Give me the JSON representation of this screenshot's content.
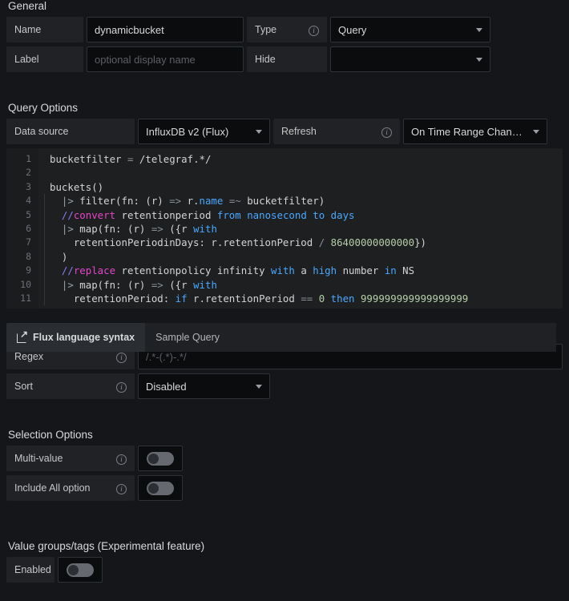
{
  "general": {
    "title": "General",
    "name_label": "Name",
    "name_value": "dynamicbucket",
    "label_label": "Label",
    "label_placeholder": "optional display name",
    "type_label": "Type",
    "type_value": "Query",
    "hide_label": "Hide",
    "hide_value": ""
  },
  "query_options": {
    "title": "Query Options",
    "datasource_label": "Data source",
    "datasource_value": "InfluxDB v2 (Flux)",
    "refresh_label": "Refresh",
    "refresh_value": "On Time Range Chan…"
  },
  "editor": {
    "line_numbers": [
      "1",
      "2",
      "3",
      "4",
      "5",
      "6",
      "7",
      "8",
      "9",
      "10",
      "11"
    ],
    "lines": [
      "bucketfilter = /telegraf.*/",
      "",
      "buckets()",
      "  |> filter(fn: (r) => r.name =~ bucketfilter)",
      "  //convert retentionperiod from nanosecond to days",
      "  |> map(fn: (r) => ({r with",
      "    retentionPeriodinDays: r.retentionPeriod / 86400000000000})",
      "  )",
      "  //replace retentionpolicy infinity with a high number in NS",
      "  |> map(fn: (r) => ({r with",
      "    retentionPeriod: if r.retentionPeriod == 0 then 999999999999999999"
    ]
  },
  "tabs": {
    "flux_syntax": "Flux language syntax",
    "sample_query": "Sample Query",
    "ext_link_icon": "external-link-icon"
  },
  "filters": {
    "regex_label": "Regex",
    "regex_placeholder": "/.*-(.*)-.*/",
    "regex_value": "",
    "sort_label": "Sort",
    "sort_value": "Disabled"
  },
  "selection_options": {
    "title": "Selection Options",
    "multi_value_label": "Multi-value",
    "multi_value_on": false,
    "include_all_label": "Include All option",
    "include_all_on": false
  },
  "value_groups": {
    "title": "Value groups/tags (Experimental feature)",
    "enabled_label": "Enabled",
    "enabled_on": false
  },
  "colors": {
    "page_bg": "#141619",
    "field_label_bg": "#202226",
    "input_bg": "#0b0c0e",
    "editor_bg": "#1d1f21",
    "text": "#d8d9da"
  }
}
